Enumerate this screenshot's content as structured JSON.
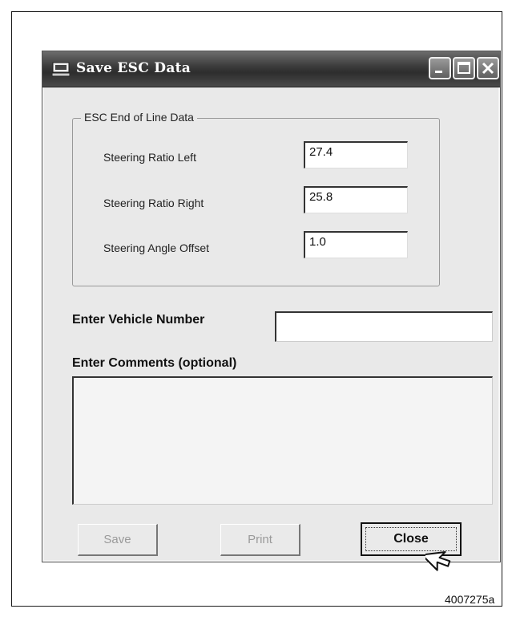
{
  "window": {
    "title": "Save ESC Data"
  },
  "group": {
    "legend": "ESC End of Line Data",
    "fields": [
      {
        "label": "Steering Ratio Left",
        "value": "27.4"
      },
      {
        "label": "Steering Ratio Right",
        "value": "25.8"
      },
      {
        "label": "Steering Angle Offset",
        "value": "1.0"
      }
    ]
  },
  "vehicle": {
    "label": "Enter Vehicle Number",
    "value": ""
  },
  "comments": {
    "label": "Enter Comments (optional)",
    "value": ""
  },
  "buttons": {
    "save": "Save",
    "print": "Print",
    "close": "Close"
  },
  "caption": "4007275a",
  "icons": [
    "app-icon",
    "minimize-icon",
    "maximize-icon",
    "close-icon",
    "mouse-cursor-icon"
  ]
}
